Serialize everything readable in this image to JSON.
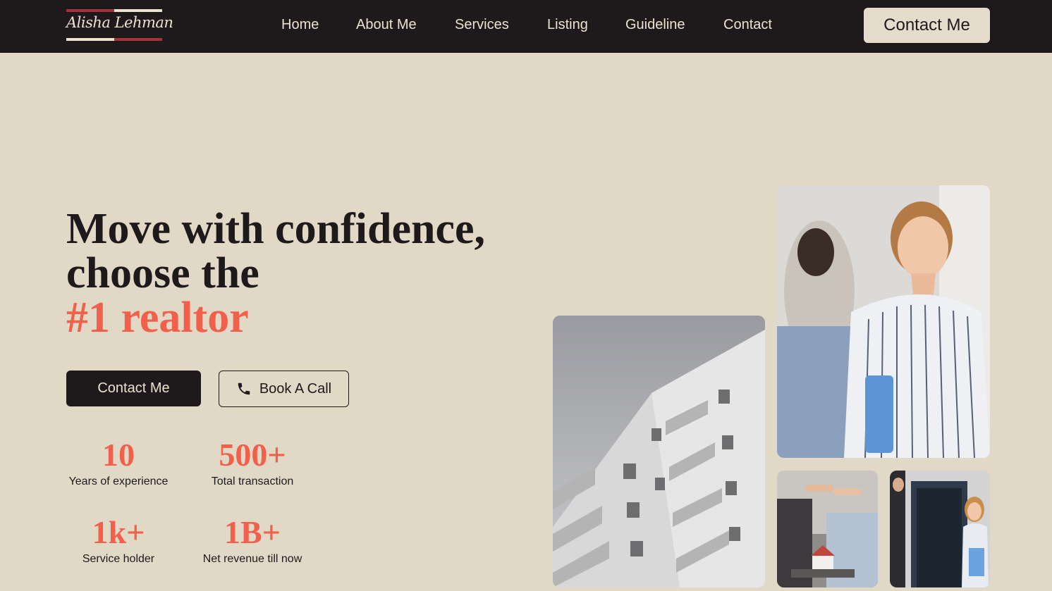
{
  "header": {
    "logo_text": "Alisha Lehman",
    "nav": [
      {
        "label": "Home"
      },
      {
        "label": "About Me"
      },
      {
        "label": "Services"
      },
      {
        "label": "Listing"
      },
      {
        "label": "Guideline"
      },
      {
        "label": "Contact"
      }
    ],
    "cta_label": "Contact Me"
  },
  "hero": {
    "headline_line1": "Move with confidence,",
    "headline_line2": "choose the",
    "headline_accent": "#1 realtor",
    "primary_button": "Contact Me",
    "secondary_button": "Book A Call",
    "stats": [
      {
        "value": "10",
        "label": "Years of experience"
      },
      {
        "value": "500+",
        "label": "Total transaction"
      },
      {
        "value": "1k+",
        "label": "Service holder"
      },
      {
        "value": "1B+",
        "label": "Net revenue till now"
      }
    ]
  },
  "gallery": {
    "images": [
      {
        "subject": "white apartment building"
      },
      {
        "subject": "smiling realtor woman holding folder"
      },
      {
        "subject": "handing over house keys"
      },
      {
        "subject": "realtor at open door"
      }
    ]
  },
  "colors": {
    "navbar_bg": "#1e1a1b",
    "page_bg": "#e1d8c6",
    "accent": "#f1604b",
    "logo_red": "#a8323a"
  }
}
